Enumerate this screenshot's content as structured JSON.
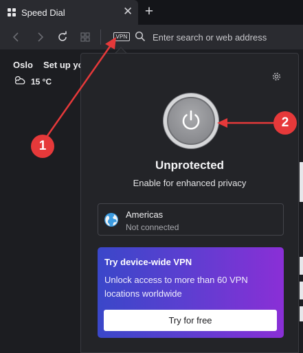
{
  "tab": {
    "title": "Speed Dial",
    "icon": "speed-dial-grid-icon",
    "close_glyph": "✕",
    "new_tab_glyph": "+"
  },
  "address_bar": {
    "vpn_badge": "VPN",
    "placeholder": "Enter search or web address"
  },
  "weather": {
    "city": "Oslo",
    "setup_text": "Set up your",
    "temperature": "15 °C",
    "icon": "cloudy-icon"
  },
  "vpn_popup": {
    "status_title": "Unprotected",
    "status_subtitle": "Enable for enhanced privacy",
    "location": {
      "name": "Americas",
      "status": "Not connected",
      "icon": "globe-icon"
    },
    "promo": {
      "title": "Try device-wide VPN",
      "body": "Unlock access to more than 60 VPN locations worldwide",
      "button": "Try for free"
    }
  },
  "annotations": {
    "callout_1": "1",
    "callout_2": "2",
    "color": "#e6393a"
  }
}
